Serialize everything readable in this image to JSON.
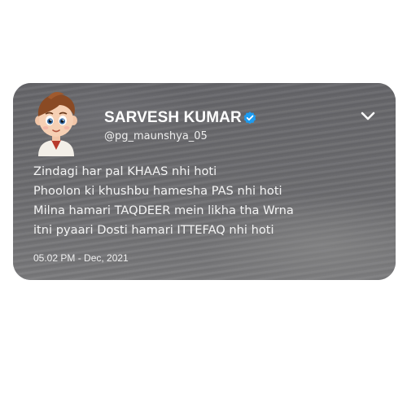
{
  "tweet": {
    "author": {
      "display_name": "SARVESH KUMAR",
      "handle": "@pg_maunshya_05",
      "verified": true,
      "avatar_icon": "cartoon-boy-avatar"
    },
    "lines": [
      "Zindagi har pal KHAAS nhi hoti",
      "Phoolon ki khushbu hamesha PAS nhi hoti",
      "Milna hamari TAQDEER mein likha tha Wrna",
      "itni pyaari Dosti hamari ITTEFAQ nhi hoti"
    ],
    "timestamp": "05.02 PM - Dec, 2021",
    "menu_icon": "chevron-down-icon"
  },
  "colors": {
    "card_background": "#6a6a6e",
    "text": "#ffffff",
    "verified_badge": "#1d9bf0"
  }
}
